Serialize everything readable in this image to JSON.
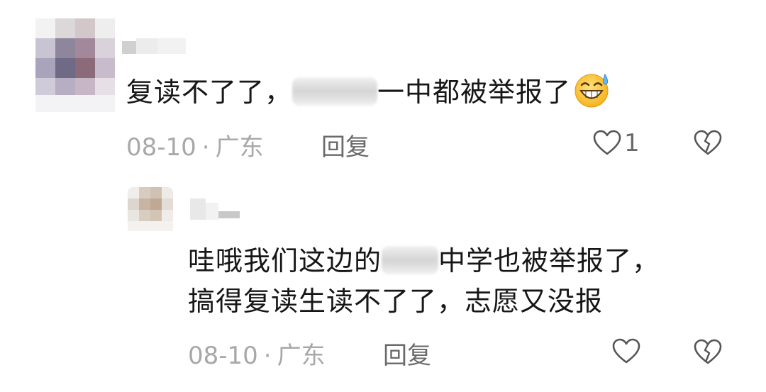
{
  "comments": [
    {
      "text_before": "复读不了了，",
      "text_after": "一中都被举报了",
      "emoji": "grinning-sweat-emoji",
      "date": "08-10",
      "separator": "·",
      "location": "广东",
      "reply_label": "回复",
      "like_count": "1"
    },
    {
      "line1_before": "哇哦我们这边的",
      "line1_after": "中学也被举报了，",
      "line2": "搞得复读生读不了了，志愿又没报",
      "date": "08-10",
      "separator": "·",
      "location": "广东",
      "reply_label": "回复",
      "like_count": ""
    }
  ],
  "colors": {
    "text": "#161616",
    "meta": "#a8a8a8",
    "action": "#6a6a6a",
    "icon": "#555555"
  }
}
